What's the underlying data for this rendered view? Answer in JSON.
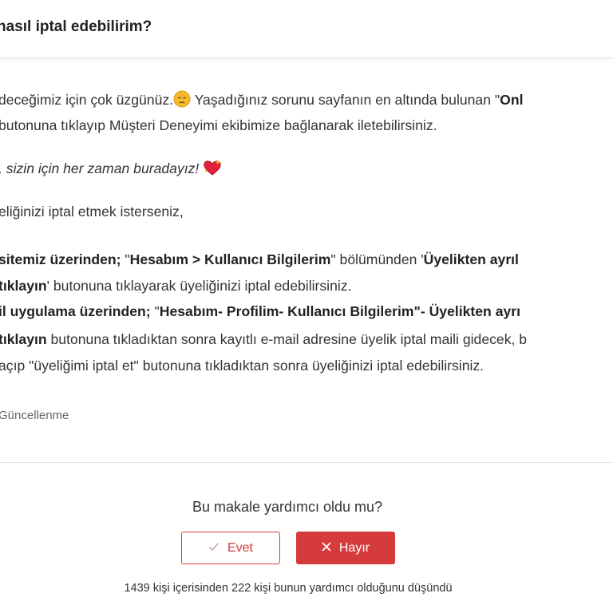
{
  "header": {
    "title": "nasıl iptal edebilirim?"
  },
  "article": {
    "p1_l1_a": "deceğimiz için çok üzgünüz.",
    "p1_l1_b": " Yaşadığınız sorunu sayfanın en altında bulunan \"",
    "p1_l1_bold": "Onl",
    "p1_l2": "butonuna tıklayıp Müşteri Deneyimi ekibimize bağlanarak iletebilirsiniz.",
    "p2": ", sizin için her zaman buradayız!",
    "p3": "eliğinizi iptal etmek isterseniz,",
    "web_l1_bold1": " sitemiz üzerinden;",
    "web_l1_a": " \"",
    "web_l1_bold2": "Hesabım > Kullanıcı Bilgilerim",
    "web_l1_b": "\" bölümünden '",
    "web_l1_bold3": "Üyelikten ayrıl",
    "web_l2_bold": "tıklayın",
    "web_l2_a": "' butonuna tıklayarak üyeliğinizi iptal edebilirsiniz.",
    "app_l1_bold1": "il uygulama üzerinden;",
    "app_l1_a": "  \"",
    "app_l1_bold2": "Hesabım- Profilim- Kullanıcı Bilgilerim\"- Üyelikten ayrı",
    "app_l2_bold": "tıklayın",
    "app_l2_a": " butonuna tıkladıktan sonra kayıtlı e-mail adresine üyelik iptal maili gidecek, b",
    "app_l3": " açıp \"üyeliğimi iptal et\" butonuna tıkladıktan sonra üyeliğinizi iptal edebilirsiniz.",
    "updated": "Güncellenme"
  },
  "feedback": {
    "question": "Bu makale yardımcı oldu mu?",
    "yes_label": "Evet",
    "no_label": "Hayır",
    "stats": "1439 kişi içerisinden 222 kişi bunun yardımcı olduğunu düşündü"
  },
  "icons": {
    "sad_face": "sad-face-emoji",
    "heart": "sparkling-heart-emoji",
    "check": "check-icon",
    "close": "close-icon"
  },
  "colors": {
    "accent": "#d53b3b",
    "text": "#333333"
  }
}
